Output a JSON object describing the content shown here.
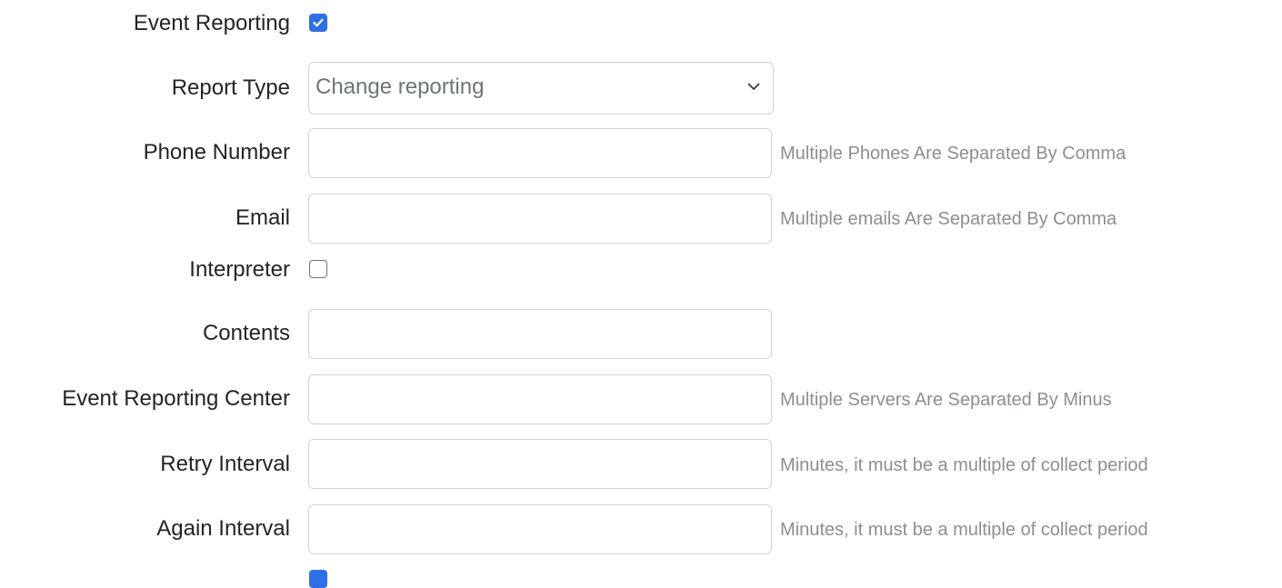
{
  "form": {
    "event_reporting": {
      "label": "Event Reporting",
      "checked": true
    },
    "report_type": {
      "label": "Report Type",
      "selected": "Change reporting"
    },
    "phone_number": {
      "label": "Phone Number",
      "value": "",
      "hint": "Multiple Phones Are Separated By Comma"
    },
    "email": {
      "label": "Email",
      "value": "",
      "hint": "Multiple emails Are Separated By Comma"
    },
    "interpreter": {
      "label": "Interpreter",
      "checked": false
    },
    "contents": {
      "label": "Contents",
      "value": ""
    },
    "event_reporting_center": {
      "label": "Event Reporting Center",
      "value": "",
      "hint": "Multiple Servers Are Separated By Minus"
    },
    "retry_interval": {
      "label": "Retry Interval",
      "value": "",
      "hint": "Minutes, it must be a multiple of collect period"
    },
    "again_interval": {
      "label": "Again Interval",
      "value": "",
      "hint": "Minutes, it must be a multiple of collect period"
    },
    "next_checkbox": {
      "checked": true
    }
  },
  "colors": {
    "accent": "#2f6fe4",
    "border": "#ced4da",
    "hint": "#8a8f94",
    "text": "#212529"
  },
  "icons": {
    "select_arrow": "chevron-down-icon",
    "check": "check-icon"
  }
}
